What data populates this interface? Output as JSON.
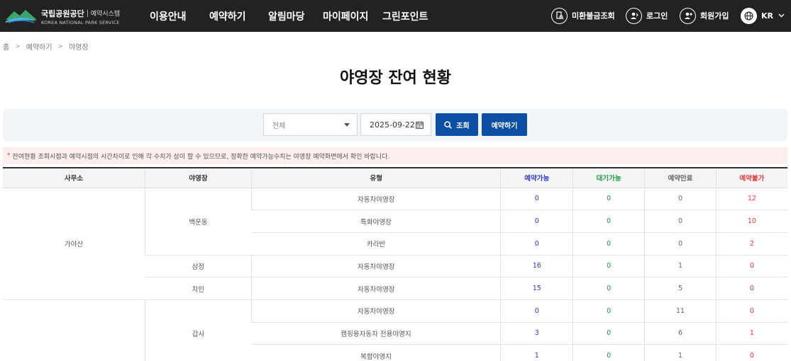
{
  "header": {
    "logo_main": "국립공원공단",
    "logo_sub": "예약시스템",
    "logo_en": "KOREA NATIONAL PARK SERVICE",
    "nav": [
      "이용안내",
      "예약하기",
      "알림마당",
      "마이페이지",
      "그린포인트"
    ],
    "util": {
      "refund": "미환불금조회",
      "login": "로그인",
      "signup": "회원가입",
      "lang": "KR"
    }
  },
  "breadcrumb": [
    "홈",
    "예약하기",
    "야영장"
  ],
  "page_title": "야영장 잔여 현황",
  "search": {
    "select_value": "전체",
    "date_value": "2025-09-22",
    "search_button": "조회",
    "reserve_button": "예약하기"
  },
  "notice": "잔여현황 조회시점과 예약시점의 시간차이로 인해 각 수치가 상이 할 수 있으므로, 정확한 예약가능수치는 야영장 예약화면에서 확인 바랍니다.",
  "table": {
    "headers": [
      "사무소",
      "야영장",
      "유형",
      "예약가능",
      "대기가능",
      "예약만료",
      "예약불가"
    ],
    "colors": {
      "avail": "#2b3ac4",
      "wait": "#1e9a3d",
      "done": "#666666",
      "no": "#e23b3b"
    },
    "groups": [
      {
        "office": "가야산",
        "sites": [
          {
            "name": "백운동",
            "rows": [
              {
                "type": "자동차야영장",
                "avail": "0",
                "wait": "0",
                "done": "0",
                "no": "12"
              },
              {
                "type": "특화야영장",
                "avail": "0",
                "wait": "0",
                "done": "0",
                "no": "10"
              },
              {
                "type": "카라반",
                "avail": "0",
                "wait": "0",
                "done": "0",
                "no": "2"
              }
            ]
          },
          {
            "name": "삼정",
            "rows": [
              {
                "type": "자동차야영장",
                "avail": "16",
                "wait": "0",
                "done": "1",
                "no": "0"
              }
            ]
          },
          {
            "name": "치인",
            "rows": [
              {
                "type": "자동차야영장",
                "avail": "15",
                "wait": "0",
                "done": "5",
                "no": "0"
              }
            ]
          }
        ]
      },
      {
        "office": "",
        "sites": [
          {
            "name": "갑사",
            "rows": [
              {
                "type": "자동차야영장",
                "avail": "0",
                "wait": "0",
                "done": "11",
                "no": "0"
              },
              {
                "type": "캠핑용자동차 전용야영지",
                "avail": "3",
                "wait": "0",
                "done": "6",
                "no": "1"
              },
              {
                "type": "복합야영지",
                "avail": "1",
                "wait": "0",
                "done": "1",
                "no": "0"
              }
            ]
          }
        ]
      }
    ]
  }
}
